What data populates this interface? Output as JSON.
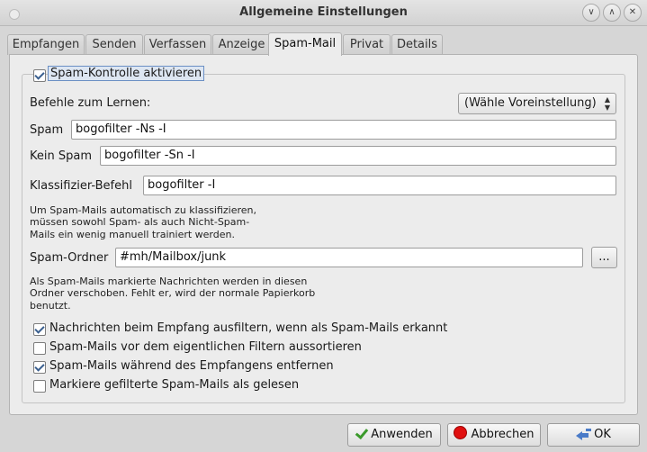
{
  "window": {
    "title": "Allgemeine Einstellungen"
  },
  "tabs": [
    {
      "label": "Empfangen"
    },
    {
      "label": "Senden"
    },
    {
      "label": "Verfassen"
    },
    {
      "label": "Anzeige"
    },
    {
      "label": "Spam-Mail"
    },
    {
      "label": "Privat"
    },
    {
      "label": "Details"
    }
  ],
  "active_tab": "Spam-Mail",
  "spam": {
    "enable_label": "Spam-Kontrolle aktivieren",
    "enable_checked": true,
    "learn_label": "Befehle zum Lernen:",
    "preset_value": "(Wähle Voreinstellung)",
    "spam_label": "Spam",
    "spam_value": "bogofilter -Ns -I",
    "nospam_label": "Kein Spam",
    "nospam_value": "bogofilter -Sn -I",
    "classify_label": "Klassifizier-Befehl",
    "classify_value": "bogofilter -I",
    "info1_line1": "Um Spam-Mails automatisch zu klassifizieren,",
    "info1_line2": "müssen sowohl Spam- als auch Nicht-Spam-",
    "info1_line3": "Mails ein wenig manuell trainiert werden.",
    "folder_label": "Spam-Ordner",
    "folder_value": "#mh/Mailbox/junk",
    "browse_label": "...",
    "info2_line1": "Als Spam-Mails markierte Nachrichten werden in diesen",
    "info2_line2": "Ordner verschoben. Fehlt er, wird der normale Papierkorb",
    "info2_line3": "benutzt.",
    "options": [
      {
        "label": "Nachrichten beim Empfang ausfiltern, wenn als Spam-Mails erkannt",
        "checked": true
      },
      {
        "label": "Spam-Mails vor dem eigentlichen Filtern aussortieren",
        "checked": false
      },
      {
        "label": "Spam-Mails während des Empfangens entfernen",
        "checked": true
      },
      {
        "label": "Markiere gefilterte Spam-Mails als gelesen",
        "checked": false
      }
    ]
  },
  "buttons": {
    "apply": "Anwenden",
    "cancel": "Abbrechen",
    "ok": "OK"
  },
  "icons": {
    "apply": "green-check-icon",
    "cancel": "red-stop-icon",
    "ok": "blue-enter-arrow-icon"
  }
}
